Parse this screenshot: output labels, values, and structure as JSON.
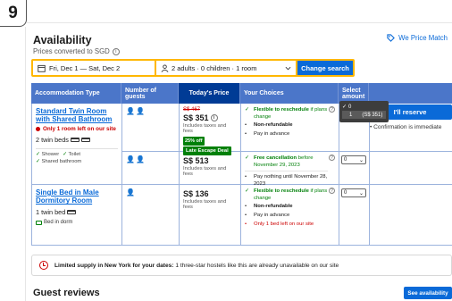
{
  "step": "9",
  "header": {
    "title": "Availability",
    "subtitle": "Prices converted to SGD",
    "price_match": "We Price Match"
  },
  "search": {
    "dates": "Fri, Dec 1  —  Sat, Dec 2",
    "guests": "2 adults · 0 children · 1 room",
    "button": "Change search"
  },
  "table_headers": {
    "type": "Accommodation Type",
    "guests": "Number of guests",
    "price": "Today's Price",
    "choices": "Your Choices",
    "amount": "Select amount"
  },
  "room1": {
    "name": "Standard Twin Room with Shared Bathroom",
    "warning": "Only 1 room left on our site",
    "beds": "2 twin beds",
    "amenities": [
      "Shower",
      "Toilet",
      "Shared bathroom"
    ],
    "opt1": {
      "old_price": "S$ 467",
      "price": "S$ 351",
      "taxes": "Includes taxes and fees",
      "discount": "25% off",
      "deal": "Late Escape Deal",
      "flex_bold": "Flexible to reschedule",
      "flex_rest": " if plans change",
      "nonref": "Non-refundable",
      "pay": "Pay in advance"
    },
    "opt2": {
      "price": "S$ 513",
      "taxes": "Includes taxes and fees",
      "cancel_bold": "Free cancellation",
      "cancel_rest": " before November 29, 2023",
      "pay": "Pay nothing until November 28, 2023",
      "select_value": "0"
    }
  },
  "room2": {
    "name": "Single Bed in Male Dormitory Room",
    "beds": "1 twin bed",
    "dorm": "Bed in dorm",
    "price": "S$ 136",
    "taxes": "Includes taxes and fees",
    "flex_bold": "Flexible to reschedule",
    "flex_rest": " if plans change",
    "nonref": "Non-refundable",
    "pay": "Pay in advance",
    "left": "Only 1 bed left on our site",
    "select_value": "0"
  },
  "dropdown": {
    "options": [
      {
        "label": "0",
        "extra": ""
      },
      {
        "label": "1",
        "extra": "(S$ 351)"
      }
    ]
  },
  "reserve": {
    "button": "I'll reserve",
    "note": "Confirmation is immediate"
  },
  "notice": {
    "bold": "Limited supply in New York for your dates:",
    "rest": " 1 three-star hostels like this are already unavailable on our site"
  },
  "reviews": {
    "title": "Guest reviews",
    "button": "See availability"
  },
  "colors": {
    "accent": "#0a6ad8",
    "header_blue": "#4b76c9",
    "dark_blue": "#003b95",
    "search_border": "#ffb700",
    "green": "#008009",
    "red": "#cc0000"
  }
}
